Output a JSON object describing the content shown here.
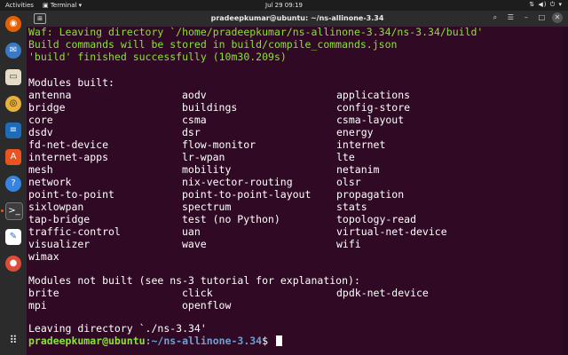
{
  "topbar": {
    "activities": "Activities",
    "app": "Terminal",
    "clock": "Jul 29  09:19"
  },
  "window": {
    "title": "pradeepkumar@ubuntu: ~/ns-allinone-3.34"
  },
  "lines": {
    "l1": "Waf: Leaving directory `/home/pradeepkumar/ns-allinone-3.34/ns-3.34/build'",
    "l2": "Build commands will be stored in build/compile_commands.json",
    "l3": "'build' finished successfully (10m30.209s)",
    "built_header": "Modules built:",
    "not_built_header": "Modules not built (see ns-3 tutorial for explanation):",
    "leaving": "Leaving directory `./ns-3.34'"
  },
  "modules_built": [
    [
      "antenna",
      "aodv",
      "applications"
    ],
    [
      "bridge",
      "buildings",
      "config-store"
    ],
    [
      "core",
      "csma",
      "csma-layout"
    ],
    [
      "dsdv",
      "dsr",
      "energy"
    ],
    [
      "fd-net-device",
      "flow-monitor",
      "internet"
    ],
    [
      "internet-apps",
      "lr-wpan",
      "lte"
    ],
    [
      "mesh",
      "mobility",
      "netanim"
    ],
    [
      "network",
      "nix-vector-routing",
      "olsr"
    ],
    [
      "point-to-point",
      "point-to-point-layout",
      "propagation"
    ],
    [
      "sixlowpan",
      "spectrum",
      "stats"
    ],
    [
      "tap-bridge",
      "test (no Python)",
      "topology-read"
    ],
    [
      "traffic-control",
      "uan",
      "virtual-net-device"
    ],
    [
      "visualizer",
      "wave",
      "wifi"
    ],
    [
      "wimax",
      "",
      ""
    ]
  ],
  "modules_not_built": [
    [
      "brite",
      "click",
      "dpdk-net-device"
    ],
    [
      "mpi",
      "openflow",
      ""
    ]
  ],
  "prompt": {
    "user": "pradeepkumar@ubuntu",
    "path": ":~/ns-allinone-3.34",
    "symbol": "$ "
  },
  "dock_icons": [
    "firefox-icon",
    "thunderbird-icon",
    "files-icon",
    "rhythmbox-icon",
    "writer-icon",
    "software-icon",
    "help-icon",
    "terminal-icon",
    "text-editor-icon",
    "chrome-icon",
    "apps-grid-icon"
  ],
  "colors": {
    "terminal_bg": "#300a24",
    "green": "#8ae234",
    "blue": "#729fcf",
    "accent": "#e95420"
  }
}
